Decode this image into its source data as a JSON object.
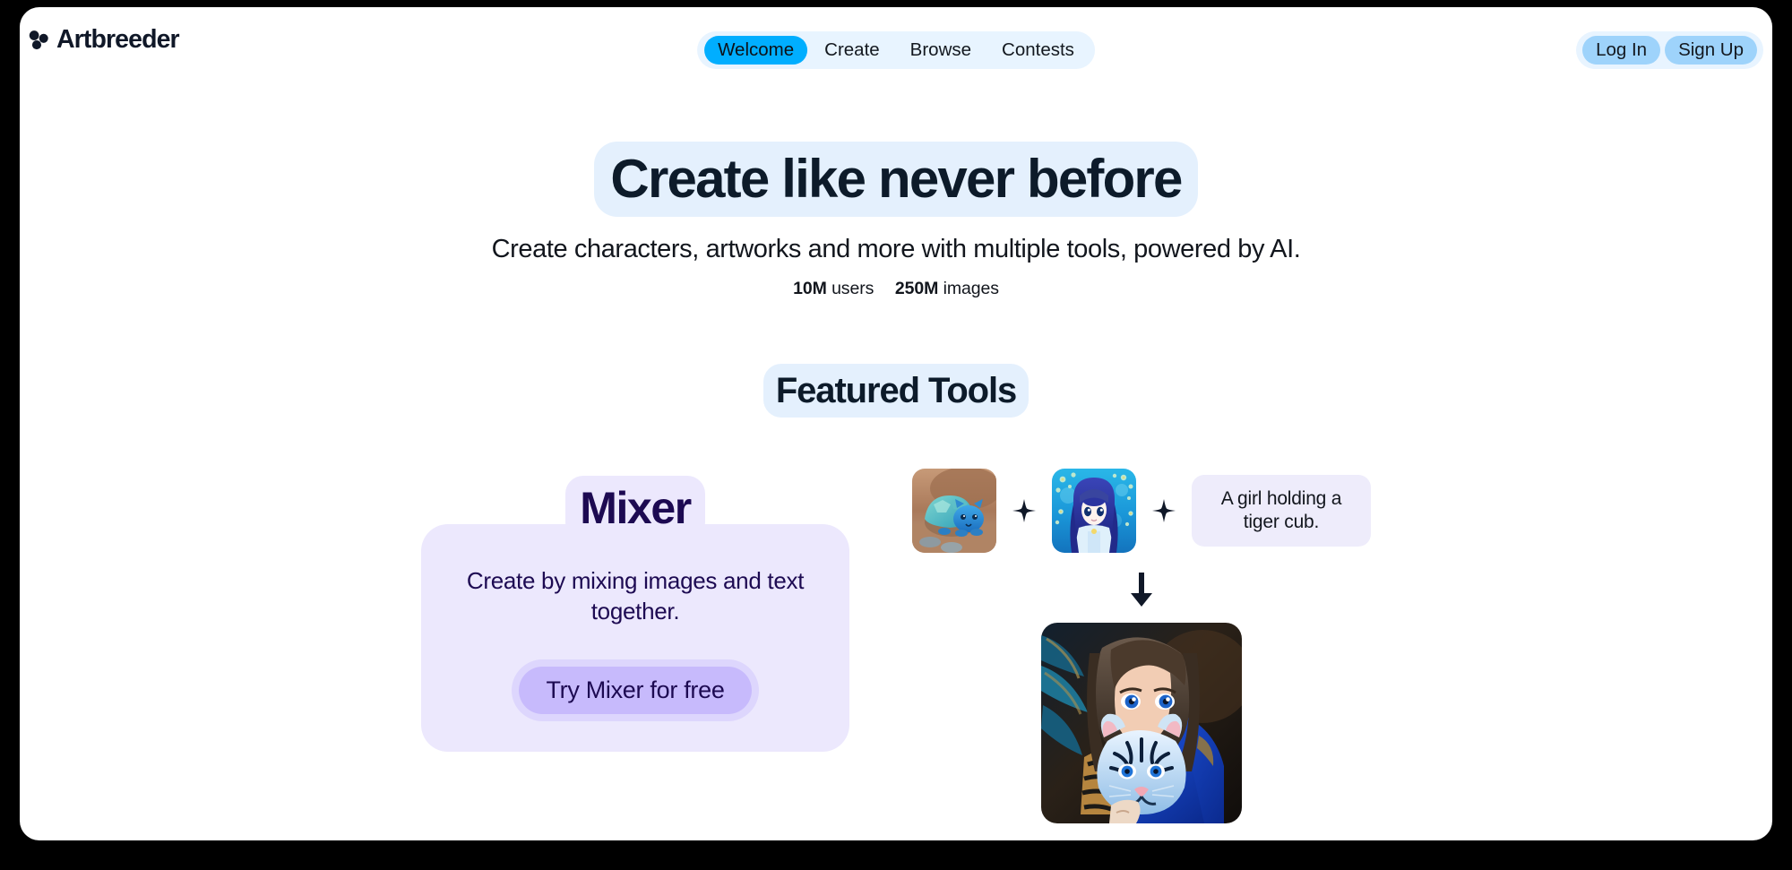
{
  "brand": {
    "name": "Artbreeder",
    "logo_icon": "trefoil-circles-icon"
  },
  "nav": {
    "items": [
      {
        "label": "Welcome",
        "active": true
      },
      {
        "label": "Create",
        "active": false
      },
      {
        "label": "Browse",
        "active": false
      },
      {
        "label": "Contests",
        "active": false
      }
    ]
  },
  "auth": {
    "login_label": "Log In",
    "signup_label": "Sign Up"
  },
  "hero": {
    "title": "Create like never before",
    "subtitle": "Create characters, artworks and more with multiple tools, powered by AI.",
    "stats": {
      "users_value": "10M",
      "users_label": "users",
      "images_value": "250M",
      "images_label": "images"
    }
  },
  "featured": {
    "heading": "Featured Tools"
  },
  "mixer": {
    "title": "Mixer",
    "description": "Create by mixing images and text together.",
    "cta_label": "Try Mixer for free"
  },
  "demo": {
    "input_one_alt": "blue turtle-cat creature",
    "plus_one": "+",
    "input_two_alt": "anime girl with long blue hair",
    "plus_two": "+",
    "prompt_text": "A girl holding a tiger cub.",
    "arrow_icon": "arrow-down-icon",
    "result_alt": "girl in blue holding a blue white tiger cub"
  },
  "colors": {
    "accent_blue": "#00aeff",
    "nav_bg": "#e8f4ff",
    "auth_btn": "#9ed3fb",
    "highlight_blue": "#e4f0fd",
    "mixer_bg": "#ece8fd",
    "mixer_btn": "#c7bafc",
    "ink": "#0d1b2a",
    "purple_ink": "#1d0a52"
  }
}
